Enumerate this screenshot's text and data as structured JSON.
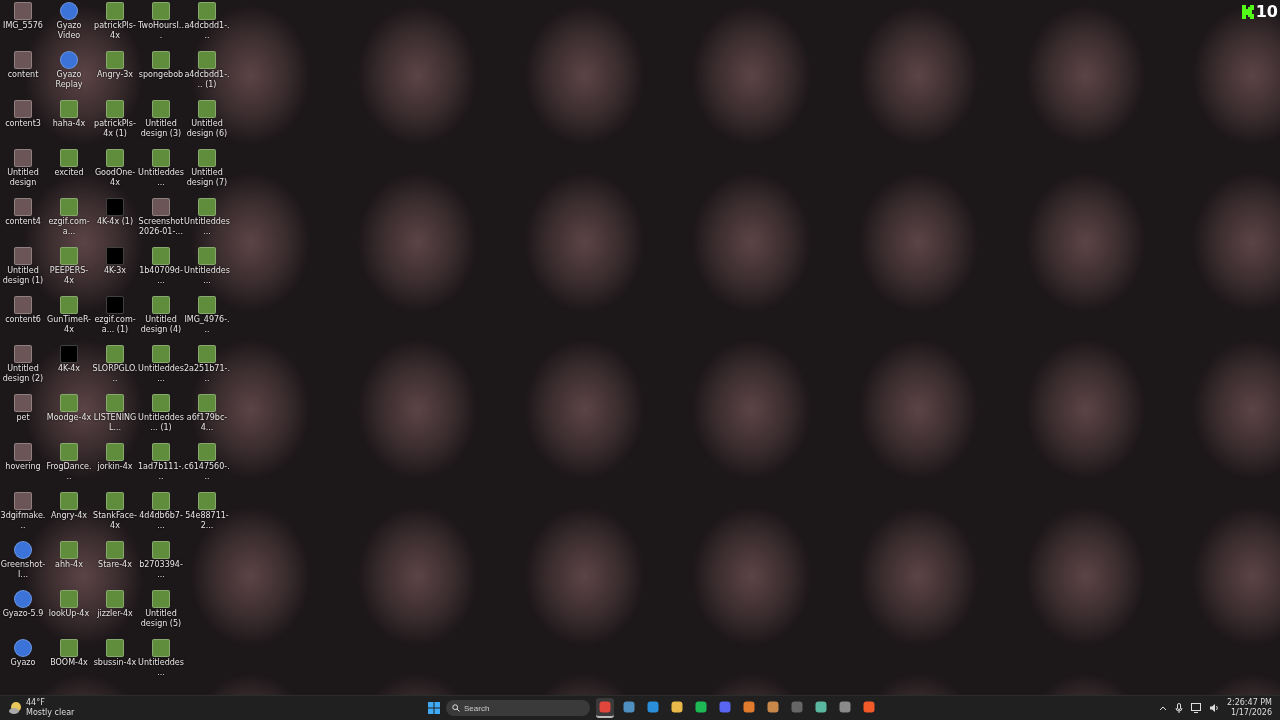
{
  "desktop": {
    "icons": [
      {
        "label": "IMG_5576",
        "kind": "photo"
      },
      {
        "label": "content",
        "kind": "photo"
      },
      {
        "label": "content3",
        "kind": "photo"
      },
      {
        "label": "Untitled design",
        "kind": "photo"
      },
      {
        "label": "content4",
        "kind": "photo"
      },
      {
        "label": "Untitled design (1)",
        "kind": "photo"
      },
      {
        "label": "content6",
        "kind": "photo"
      },
      {
        "label": "Untitled design (2)",
        "kind": "photo"
      },
      {
        "label": "pet",
        "kind": "photo"
      },
      {
        "label": "hovering",
        "kind": "photo"
      },
      {
        "label": "3dgifmake...",
        "kind": "photo"
      },
      {
        "label": "Greenshot-I...",
        "kind": "app"
      },
      {
        "label": "Gyazo-5.9",
        "kind": "app"
      },
      {
        "label": "Gyazo",
        "kind": "app"
      },
      {
        "label": "Gyazo Video",
        "kind": "app"
      },
      {
        "label": "Gyazo Replay",
        "kind": "app"
      },
      {
        "label": "haha-4x",
        "kind": "sticker"
      },
      {
        "label": "excited",
        "kind": "sticker"
      },
      {
        "label": "ezgif.com-a...",
        "kind": "sticker"
      },
      {
        "label": "PEEPERS-4x",
        "kind": "sticker"
      },
      {
        "label": "GunTimeR-4x",
        "kind": "sticker"
      },
      {
        "label": "4K-4x",
        "kind": "blank"
      },
      {
        "label": "Moodge-4x",
        "kind": "sticker"
      },
      {
        "label": "FrogDance...",
        "kind": "sticker"
      },
      {
        "label": "Angry-4x",
        "kind": "sticker"
      },
      {
        "label": "ahh-4x",
        "kind": "sticker"
      },
      {
        "label": "lookUp-4x",
        "kind": "sticker"
      },
      {
        "label": "BOOM-4x",
        "kind": "sticker"
      },
      {
        "label": "patrickPls-4x",
        "kind": "sticker"
      },
      {
        "label": "Angry-3x",
        "kind": "sticker"
      },
      {
        "label": "patrickPls-4x (1)",
        "kind": "sticker"
      },
      {
        "label": "GoodOne-4x",
        "kind": "sticker"
      },
      {
        "label": "4K-4x (1)",
        "kind": "blank"
      },
      {
        "label": "4K-3x",
        "kind": "blank"
      },
      {
        "label": "ezgif.com-a... (1)",
        "kind": "blank"
      },
      {
        "label": "SLORPGLO...",
        "kind": "sticker"
      },
      {
        "label": "LISTENINGL...",
        "kind": "sticker"
      },
      {
        "label": "jorkin-4x",
        "kind": "sticker"
      },
      {
        "label": "StankFace-4x",
        "kind": "sticker"
      },
      {
        "label": "Stare-4x",
        "kind": "sticker"
      },
      {
        "label": "jizzler-4x",
        "kind": "sticker"
      },
      {
        "label": "sbussin-4x",
        "kind": "sticker"
      },
      {
        "label": "TwoHoursI...",
        "kind": "sticker"
      },
      {
        "label": "spongebob",
        "kind": "sticker"
      },
      {
        "label": "Untitled design (3)",
        "kind": "sticker"
      },
      {
        "label": "Untitleddes...",
        "kind": "sticker"
      },
      {
        "label": "Screenshot 2026-01-...",
        "kind": "photo"
      },
      {
        "label": "1b40709d-...",
        "kind": "sticker"
      },
      {
        "label": "Untitled design (4)",
        "kind": "sticker"
      },
      {
        "label": "Untitleddes...",
        "kind": "sticker"
      },
      {
        "label": "Untitleddes... (1)",
        "kind": "sticker"
      },
      {
        "label": "1ad7b111-...",
        "kind": "sticker"
      },
      {
        "label": "4d4db6b7-...",
        "kind": "sticker"
      },
      {
        "label": "b2703394-...",
        "kind": "sticker"
      },
      {
        "label": "Untitled design (5)",
        "kind": "sticker"
      },
      {
        "label": "Untitleddes...",
        "kind": "sticker"
      },
      {
        "label": "a4dcbdd1-...",
        "kind": "sticker"
      },
      {
        "label": "a4dcbdd1-... (1)",
        "kind": "sticker"
      },
      {
        "label": "Untitled design (6)",
        "kind": "sticker"
      },
      {
        "label": "Untitled design (7)",
        "kind": "sticker"
      },
      {
        "label": "Untitleddes...",
        "kind": "sticker"
      },
      {
        "label": "Untitleddes...",
        "kind": "sticker"
      },
      {
        "label": "IMG_4976-...",
        "kind": "sticker"
      },
      {
        "label": "2a251b71-...",
        "kind": "sticker"
      },
      {
        "label": "a6f179bc-4...",
        "kind": "sticker"
      },
      {
        "label": "c6147560-...",
        "kind": "sticker"
      },
      {
        "label": "54e88711-2...",
        "kind": "sticker"
      }
    ]
  },
  "viewer_badge": {
    "count": "10"
  },
  "taskbar": {
    "weather": {
      "temperature": "44°F",
      "condition": "Mostly clear"
    },
    "search": {
      "placeholder": "Search"
    },
    "apps": [
      {
        "kind": "chrome",
        "selected": true
      },
      {
        "kind": "files",
        "selected": false
      },
      {
        "kind": "edge",
        "selected": false
      },
      {
        "kind": "folder",
        "selected": false
      },
      {
        "kind": "spotify",
        "selected": false
      },
      {
        "kind": "discord",
        "selected": false
      },
      {
        "kind": "fruity",
        "selected": false
      },
      {
        "kind": "launcher",
        "selected": false
      },
      {
        "kind": "obs",
        "selected": false
      },
      {
        "kind": "terminal-app",
        "selected": false
      },
      {
        "kind": "window",
        "selected": false
      },
      {
        "kind": "brave",
        "selected": false
      }
    ],
    "time": "2:26:47 PM",
    "date": "1/17/2026"
  }
}
